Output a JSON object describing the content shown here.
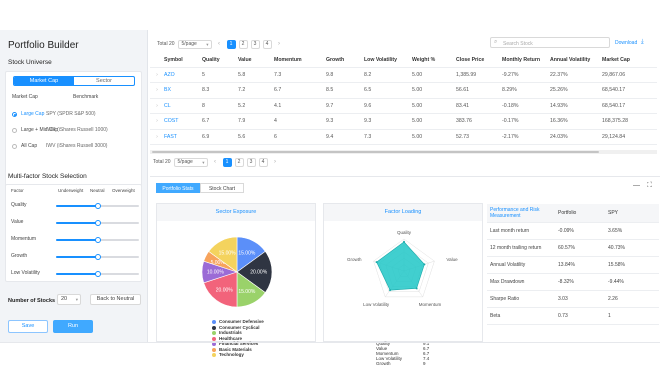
{
  "app": {
    "title": "Portfolio Builder"
  },
  "colors": {
    "accent": "#1890ff",
    "chart_teal": "#20c7c7"
  },
  "sidebar": {
    "universe": {
      "title": "Stock Universe",
      "tabs": [
        "Market Cap",
        "Sector"
      ],
      "active_tab": "Market Cap",
      "col_headers": [
        "Market Cap",
        "Benchmark"
      ],
      "options": [
        {
          "label": "Large Cap",
          "benchmark": "SPY (SPDR S&P 500)",
          "selected": true
        },
        {
          "label": "Large + Mid Cap",
          "benchmark": "IWR (iShares Russell 1000)",
          "selected": false
        },
        {
          "label": "All Cap",
          "benchmark": "IWV (iShares Russell 3000)",
          "selected": false
        }
      ]
    },
    "factors": {
      "title": "Multi-factor Stock Selection",
      "col_headers": [
        "Factor",
        "Underweight",
        "Neutral",
        "Overweight"
      ],
      "rows": [
        {
          "label": "Quality",
          "level": 0.5
        },
        {
          "label": "Value",
          "level": 0.5
        },
        {
          "label": "Momentum",
          "level": 0.5
        },
        {
          "label": "Growth",
          "level": 0.5
        },
        {
          "label": "Low Volatility",
          "level": 0.5
        }
      ]
    },
    "num_stocks": {
      "label": "Number of Stocks",
      "value": "20",
      "reset_label": "Back to Neutral"
    },
    "actions": {
      "save": "Save",
      "run": "Run"
    }
  },
  "main": {
    "pager": {
      "total": "Total 20",
      "page_size": "5/page",
      "pages": [
        "1",
        "2",
        "3",
        "4"
      ],
      "current": "1",
      "prev": "‹",
      "next": "›",
      "dropdown_caret": "▾"
    },
    "search": {
      "placeholder": "Search Stock",
      "icon": "search-icon",
      "glyph": "⌕"
    },
    "download": {
      "label": "Download",
      "icon": "download-icon",
      "glyph": "⤓"
    },
    "table": {
      "headers": [
        "Symbol",
        "Quality",
        "Value",
        "Momentum",
        "Growth",
        "Low Volatility",
        "Weight %",
        "Close Price",
        "Monthly Return",
        "Annual Volatility",
        "Market Cap"
      ],
      "expand_glyph": "›",
      "rows": [
        [
          "AZO",
          "5",
          "5.8",
          "7.3",
          "9.8",
          "8.2",
          "5.00",
          "1,385.99",
          "-9.27%",
          "22.37%",
          "29,867.06"
        ],
        [
          "BX",
          "8.3",
          "7.2",
          "6.7",
          "8.5",
          "6.5",
          "5.00",
          "56.61",
          "8.29%",
          "25.26%",
          "68,540.17"
        ],
        [
          "CL",
          "8",
          "5.2",
          "4.1",
          "9.7",
          "9.6",
          "5.00",
          "83.41",
          "-0.18%",
          "14.93%",
          "68,540.17"
        ],
        [
          "COST",
          "6.7",
          "7.9",
          "4",
          "9.3",
          "9.3",
          "5.00",
          "383.76",
          "-0.17%",
          "16.36%",
          "168,375.28"
        ],
        [
          "FAST",
          "6.9",
          "5.6",
          "6",
          "9.4",
          "7.3",
          "5.00",
          "52.73",
          "-2.17%",
          "24.03%",
          "29,124.84"
        ]
      ]
    },
    "lower": {
      "tabs": [
        "Portfolio Stats",
        "Stock Chart"
      ],
      "active_tab": "Portfolio Stats",
      "window_controls": {
        "minimize_glyph": "—",
        "maximize_glyph": "⛶"
      },
      "sector_panel": {
        "title": "Sector Exposure"
      },
      "factor_panel": {
        "title": "Factor Loading",
        "axes": [
          "Quality",
          "Value",
          "Momentum",
          "Low Volatility",
          "Growth"
        ],
        "values": [
          {
            "label": "Quality",
            "value": "9.1"
          },
          {
            "label": "Value",
            "value": "6.7"
          },
          {
            "label": "Momentum",
            "value": "6.7"
          },
          {
            "label": "Low Volatility",
            "value": "7.4"
          },
          {
            "label": "Growth",
            "value": "9"
          }
        ]
      },
      "performance": {
        "headers": [
          "Performance and Risk Measurement",
          "Portfolio",
          "SPY"
        ],
        "rows": [
          [
            "Last month return",
            "-0.09%",
            "3.65%"
          ],
          [
            "12 month trailing return",
            "60.57%",
            "40.73%"
          ],
          [
            "Annual Volatility",
            "13.84%",
            "15.58%"
          ],
          [
            "Max Drawdown",
            "-8.32%",
            "-9.44%"
          ],
          [
            "Sharpe Ratio",
            "3.03",
            "2.26"
          ],
          [
            "Beta",
            "0.73",
            "1"
          ]
        ]
      }
    }
  },
  "chart_data": [
    {
      "type": "pie",
      "categories": [
        "Consumer Defensive",
        "Consumer Cyclical",
        "Industrials",
        "Healthcare",
        "Financial Services",
        "Basic Materials",
        "Technology"
      ],
      "values": [
        15.0,
        20.0,
        15.0,
        20.0,
        10.0,
        5.0,
        15.0
      ],
      "colors": [
        "#5b8ff9",
        "#2f3542",
        "#9ad26a",
        "#f2637b",
        "#9b6bd6",
        "#f7a35c",
        "#f4d35e"
      ],
      "legend": "below"
    },
    {
      "type": "radar",
      "axes": [
        "Quality",
        "Value",
        "Momentum",
        "Low Volatility",
        "Growth"
      ],
      "values": [
        9.1,
        6.7,
        6.7,
        7.4,
        9
      ],
      "range": [
        0,
        10
      ]
    }
  ]
}
